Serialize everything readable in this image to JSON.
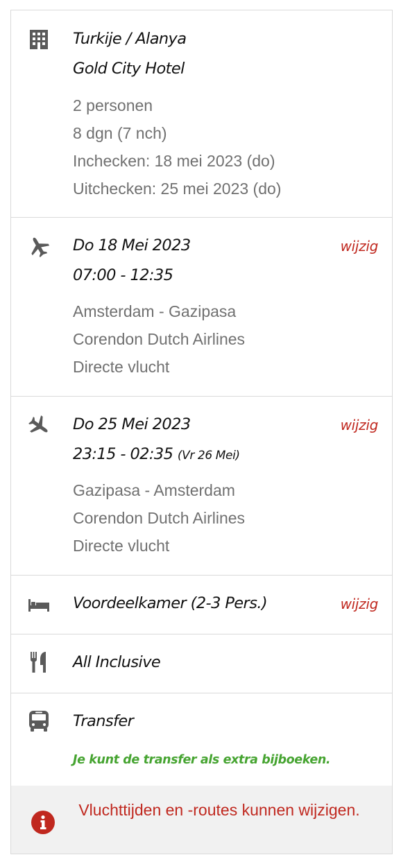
{
  "accommodation": {
    "location": "Turkije / Alanya",
    "hotel": "Gold City Hotel",
    "persons": "2 personen",
    "duration": "8 dgn (7 nch)",
    "check_in": "Inchecken: 18 mei 2023 (do)",
    "check_out": "Uitchecken: 25 mei 2023 (do)"
  },
  "outbound": {
    "date": "Do 18 Mei 2023",
    "times": "07:00 - 12:35",
    "route": "Amsterdam - Gazipasa",
    "airline": "Corendon Dutch Airlines",
    "type": "Directe vlucht",
    "edit_label": "wijzig"
  },
  "return": {
    "date": "Do 25 Mei 2023",
    "times": "23:15 - 02:35",
    "arrival_note": "(Vr 26 Mei)",
    "route": "Gazipasa - Amsterdam",
    "airline": "Corendon Dutch Airlines",
    "type": "Directe vlucht",
    "edit_label": "wijzig"
  },
  "room": {
    "label": "Voordeelkamer (2-3 Pers.)",
    "edit_label": "wijzig"
  },
  "board": {
    "label": "All Inclusive"
  },
  "transfer": {
    "label": "Transfer",
    "note": "Je kunt de transfer als extra bijboeken."
  },
  "notice": {
    "text": "Vluchttijden en -routes kunnen wijzigen."
  },
  "colors": {
    "accent_red": "#c0281f",
    "note_green": "#46a431",
    "icon_gray": "#5a5a5a"
  },
  "icons": [
    "building-icon",
    "plane-departure-icon",
    "plane-arrival-icon",
    "bed-icon",
    "utensils-icon",
    "bus-icon",
    "info-icon"
  ]
}
